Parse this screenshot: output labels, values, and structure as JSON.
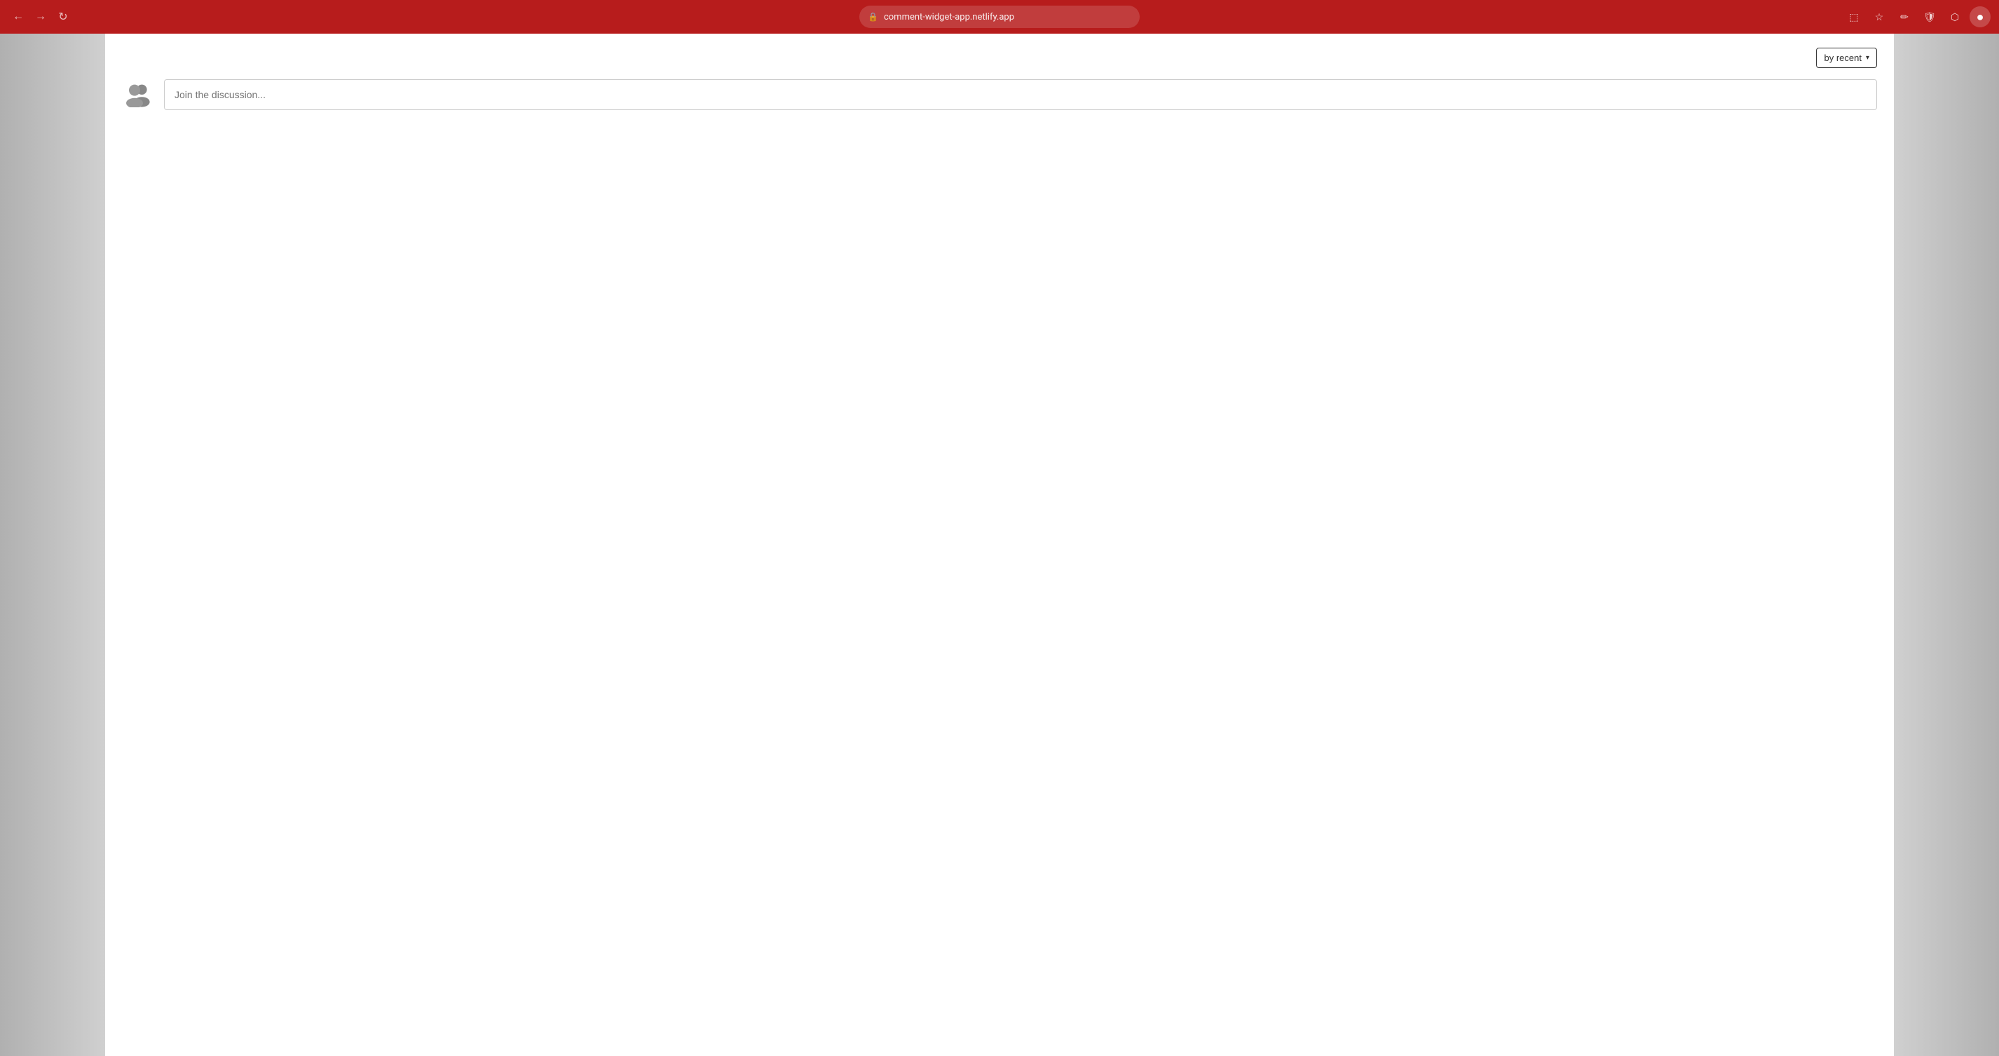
{
  "browser": {
    "url": "comment-widget-app.netlify.app",
    "back_label": "←",
    "forward_label": "→",
    "reload_label": "↻",
    "nav_icon_label": "⊕",
    "star_label": "☆",
    "edit_label": "✏",
    "shield_label": "🛡",
    "extensions_label": "⬡",
    "profile_label": "●"
  },
  "widget": {
    "sort_label": "by recent",
    "sort_chevron": "▾",
    "input_placeholder": "Join the discussion...",
    "users_icon_name": "users-icon"
  }
}
